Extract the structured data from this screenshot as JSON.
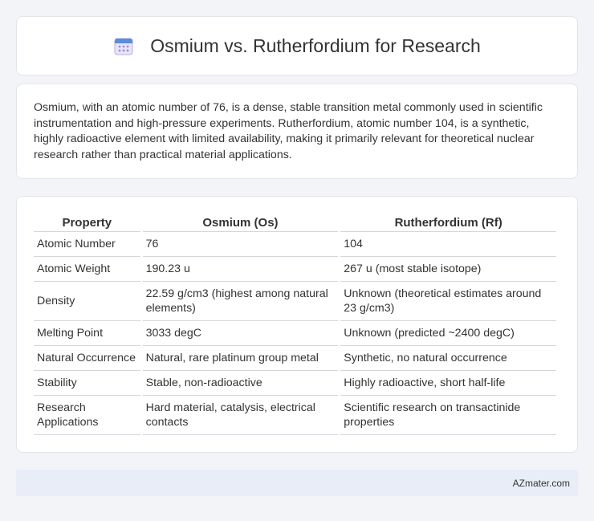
{
  "header": {
    "title": "Osmium vs. Rutherfordium for Research",
    "icon": "calendar-icon"
  },
  "intro": {
    "text": "Osmium, with an atomic number of 76, is a dense, stable transition metal commonly used in scientific instrumentation and high-pressure experiments. Rutherfordium, atomic number 104, is a synthetic, highly radioactive element with limited availability, making it primarily relevant for theoretical nuclear research rather than practical material applications."
  },
  "table": {
    "headers": [
      "Property",
      "Osmium (Os)",
      "Rutherfordium (Rf)"
    ],
    "rows": [
      {
        "property": "Atomic Number",
        "osmium": "76",
        "rutherfordium": "104"
      },
      {
        "property": "Atomic Weight",
        "osmium": "190.23 u",
        "rutherfordium": "267 u (most stable isotope)"
      },
      {
        "property": "Density",
        "osmium": "22.59 g/cm3 (highest among natural elements)",
        "rutherfordium": "Unknown (theoretical estimates around 23 g/cm3)"
      },
      {
        "property": "Melting Point",
        "osmium": "3033 degC",
        "rutherfordium": "Unknown (predicted ~2400 degC)"
      },
      {
        "property": "Natural Occurrence",
        "osmium": "Natural, rare platinum group metal",
        "rutherfordium": "Synthetic, no natural occurrence"
      },
      {
        "property": "Stability",
        "osmium": "Stable, non-radioactive",
        "rutherfordium": "Highly radioactive, short half-life"
      },
      {
        "property": "Research Applications",
        "osmium": "Hard material, catalysis, electrical contacts",
        "rutherfordium": "Scientific research on transactinide properties"
      }
    ]
  },
  "footer": {
    "brand": "AZmater.com"
  }
}
